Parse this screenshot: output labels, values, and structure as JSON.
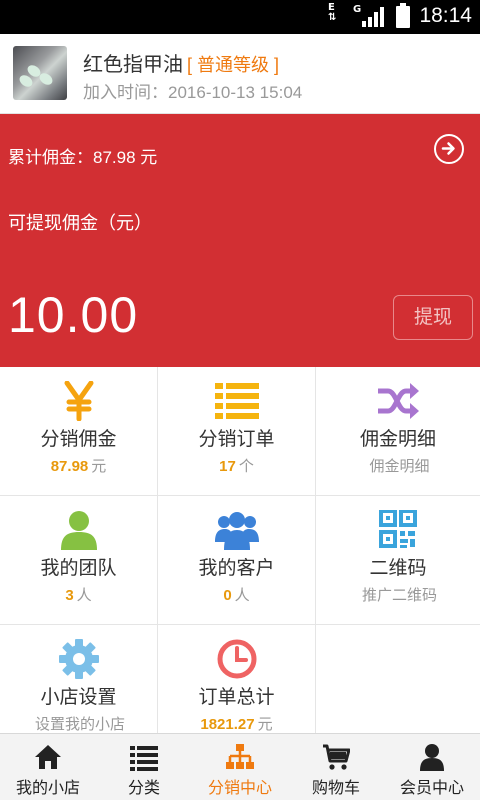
{
  "status_bar": {
    "time": "18:14",
    "network": "E",
    "network2": "G"
  },
  "profile": {
    "name": "红色指甲油",
    "level": "[ 普通等级 ]",
    "join_time": "加入时间：2016-10-13 15:04"
  },
  "banner": {
    "total_commission": "累计佣金：87.98 元",
    "withdrawable_label": "可提现佣金（元）",
    "withdrawable_amount": "10.00",
    "withdraw_button": "提现"
  },
  "grid": [
    {
      "title": "分销佣金",
      "value": "87.98",
      "unit": "元",
      "icon": "yen-icon",
      "color": "#f5a30f"
    },
    {
      "title": "分销订单",
      "value": "17",
      "unit": "个",
      "icon": "list-icon",
      "color": "#f5b40f"
    },
    {
      "title": "佣金明细",
      "value": "",
      "unit": "佣金明细",
      "icon": "shuffle-icon",
      "color": "#a875cf"
    },
    {
      "title": "我的团队",
      "value": "3",
      "unit": "人",
      "icon": "user-icon",
      "color": "#86c142"
    },
    {
      "title": "我的客户",
      "value": "0",
      "unit": "人",
      "icon": "group-icon",
      "color": "#3c82d8"
    },
    {
      "title": "二维码",
      "value": "",
      "unit": "推广二维码",
      "icon": "qrcode-icon",
      "color": "#3aa4dc"
    },
    {
      "title": "小店设置",
      "value": "",
      "unit": "设置我的小店",
      "icon": "gear-icon",
      "color": "#7bbfe8"
    },
    {
      "title": "订单总计",
      "value": "1821.27",
      "unit": "元",
      "icon": "clock-icon",
      "color": "#ef6363"
    }
  ],
  "tabs": [
    {
      "label": "我的小店",
      "icon": "home-icon",
      "active": false
    },
    {
      "label": "分类",
      "icon": "list-icon",
      "active": false
    },
    {
      "label": "分销中心",
      "icon": "sitemap-icon",
      "active": true
    },
    {
      "label": "购物车",
      "icon": "cart-icon",
      "active": false
    },
    {
      "label": "会员中心",
      "icon": "user-icon",
      "active": false
    }
  ],
  "colors": {
    "banner": "#d22f33",
    "accent": "#ef7a10",
    "highlight": "#e8990d"
  }
}
